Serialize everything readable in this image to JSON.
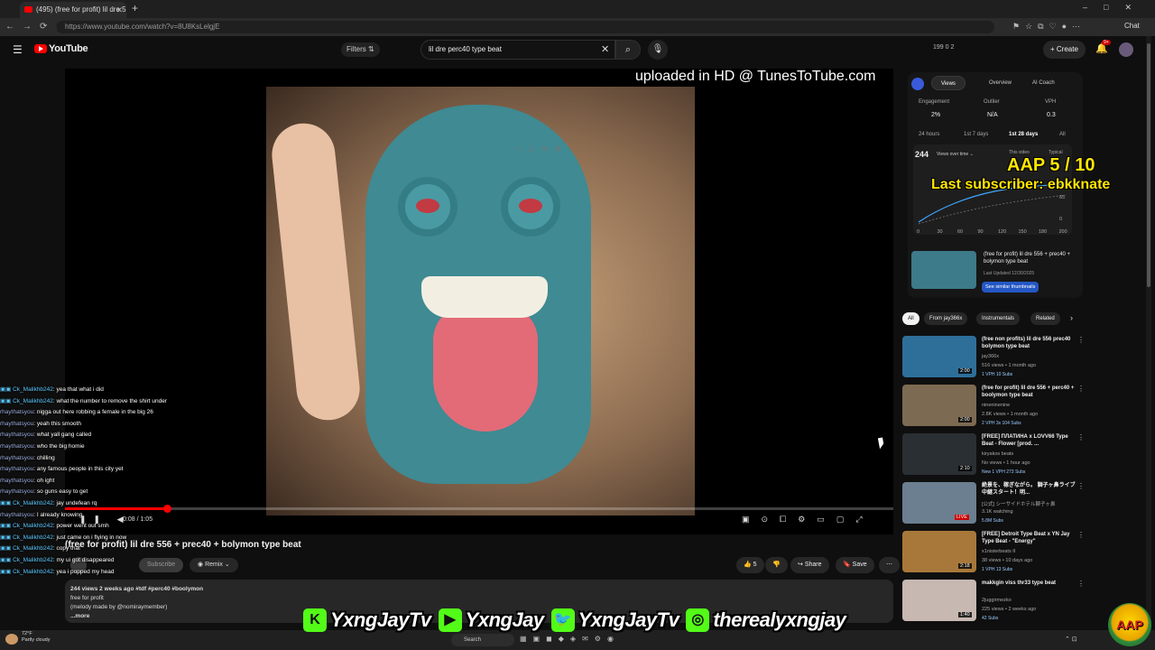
{
  "browser": {
    "tab_title": "(495) (free for profit) lil dre 556",
    "url": "https://www.youtube.com/watch?v=8U8KsLelgjE",
    "chat_label": "Chat"
  },
  "masthead": {
    "logo_text": "YouTube",
    "filters_label": "Filters",
    "search_query": "lil dre perc40 type beat",
    "stats": "199  0  2",
    "create_label": "Create",
    "notif_count": "9+"
  },
  "player": {
    "watermark": "uploaded in HD @ TunesToTube.com",
    "time": "0:08 / 1:05",
    "progress": 0.123
  },
  "video": {
    "title": "(free for profit) lil dre 556 + prec40 + bolymon type beat",
    "subscribe_label": "Subscribe",
    "remix_label": "Remix",
    "likes": "5",
    "share_label": "Share",
    "save_label": "Save",
    "desc_meta": "244 views  2 weeks ago  #tdf #perc40 #boolymon",
    "desc_line1": "free for profit",
    "desc_line2": "(melody made by @nomiraymember)",
    "desc_more": "...more"
  },
  "chat": [
    {
      "user": "Ck_Malikhb242",
      "msg": ": yea that what i did",
      "badge": true
    },
    {
      "user": "Ck_Malikhb242",
      "msg": ": what the number to remove the shirt under",
      "badge": true
    },
    {
      "user": "rhaythatsyou",
      "msg": ": nigga out here robbing a female in the big 26",
      "badge": false
    },
    {
      "user": "rhaythatsyou",
      "msg": ": yeah this smooth",
      "badge": false
    },
    {
      "user": "rhaythatsyou",
      "msg": ": what yall gang called",
      "badge": false
    },
    {
      "user": "rhaythatsyou",
      "msg": ": who the big homie",
      "badge": false
    },
    {
      "user": "rhaythatsyou",
      "msg": ": chilling",
      "badge": false
    },
    {
      "user": "rhaythatsyou",
      "msg": ": any famous people in this city yet",
      "badge": false
    },
    {
      "user": "rhaythatsyou",
      "msg": ": oh ight",
      "badge": false
    },
    {
      "user": "rhaythatsyou",
      "msg": ": so guns easy to get",
      "badge": false
    },
    {
      "user": "Ck_Malikhb242",
      "msg": ": jay undefean rq",
      "badge": true
    },
    {
      "user": "rhaythatsyou",
      "msg": ": I already knowing",
      "badge": false
    },
    {
      "user": "Ck_Malikhb242",
      "msg": ": power went out smh",
      "badge": true
    },
    {
      "user": "Ck_Malikhb242",
      "msg": ": just came on i flying in now",
      "badge": true
    },
    {
      "user": "Ck_Malikhb242",
      "msg": ": copy that",
      "badge": true
    },
    {
      "user": "Ck_Malikhb242",
      "msg": ": my ui got disappeared",
      "badge": true
    },
    {
      "user": "Ck_Malikhb242",
      "msg": ": yea i popped my head",
      "badge": true
    }
  ],
  "extension": {
    "tabs": [
      "Views",
      "Overview",
      "AI Coach"
    ],
    "stats": [
      {
        "label": "Engagement",
        "value": "2%"
      },
      {
        "label": "Outlier",
        "value": "N/A"
      },
      {
        "label": "VPH",
        "value": "0.3"
      }
    ],
    "ranges": [
      "24 hours",
      "1st 7 days",
      "1st 28 days",
      "All"
    ],
    "views_total": "244",
    "chart_label": "Views over time",
    "legend": [
      "This video",
      "Typical"
    ],
    "x_ticks": [
      "0",
      "30",
      "60",
      "90",
      "120",
      "150",
      "180",
      "200"
    ],
    "y_ticks": [
      "65",
      "0"
    ],
    "thumb_title": "(free for profit) lil dre 556 + prec40 + bolymon type beat",
    "thumb_updated": "Last Updated 12/30/2025",
    "similar_label": "See similar thumbnails"
  },
  "overlay": {
    "aap_title": "AAP 5 / 10",
    "aap_sub": "Last subscriber: ebkknate",
    "aap_logo": "AAP",
    "social": [
      {
        "icon": "kick-icon",
        "glyph": "K",
        "color": "#53fc18",
        "handle": "YxngJayTv"
      },
      {
        "icon": "youtube-icon",
        "glyph": "▶",
        "color": "#53fc18",
        "handle": "YxngJay"
      },
      {
        "icon": "twitter-icon",
        "glyph": "🐦",
        "color": "#53fc18",
        "handle": "YxngJayTv"
      },
      {
        "icon": "instagram-icon",
        "glyph": "◎",
        "color": "#53fc18",
        "handle": "therealyxngjay"
      }
    ]
  },
  "chips": [
    "All",
    "From jay366x",
    "Instrumentals",
    "Related"
  ],
  "recommended": [
    {
      "title": "(free non profits) lil dre 556 prec40 bolymon type beat",
      "channel": "jay366x",
      "meta": "516 views • 1 month ago",
      "badge": "1 VPH   10 Subs",
      "duration": "2:00",
      "color": "#2e6f9a",
      "live": false
    },
    {
      "title": "(free for profit) lil dre 556 + perc40 + boolymon type beat",
      "channel": "nineninenine",
      "meta": "2.8K views • 1 month ago",
      "badge": "2 VPH   3x   104 Subs",
      "duration": "2:00",
      "color": "#7d6a52",
      "live": false
    },
    {
      "title": "[FREE] ПЛАТИНА x LOVV66 Type Beat - Flower [prod. ...",
      "channel": "kiryakos beats",
      "meta": "No views • 1 hour ago",
      "badge": "New   1 VPH   273 Subs",
      "duration": "2:10",
      "color": "#2a2f33",
      "live": false
    },
    {
      "title": "絶景を、稼ぎながら。 獅子ヶ鼻ライブ中継スタート！明...",
      "channel": "[公式] シーサイドホテル獅子ヶ鼻",
      "meta": "3.1K watching",
      "badge": "5.8M Subs",
      "duration": "LIVE",
      "color": "#6b7f90",
      "live": true
    },
    {
      "title": "[FREE] Detroit Type Beat x YN Jay Type Beat - \"Energy\"",
      "channel": "x1nisterbeats II",
      "meta": "38 views • 10 days ago",
      "badge": "1 VPH   13 Subs",
      "duration": "2:18",
      "color": "#a8783a",
      "live": false
    },
    {
      "title": "makkgin viss thr33 type beat",
      "channel": "2juggirmezko",
      "meta": "225 views • 2 weeks ago",
      "badge": "42 Subs",
      "duration": "1:40",
      "color": "#c7b8b2",
      "live": false
    }
  ],
  "taskbar": {
    "weather_temp": "72°F",
    "weather_desc": "Partly cloudy",
    "search_label": "Search"
  }
}
